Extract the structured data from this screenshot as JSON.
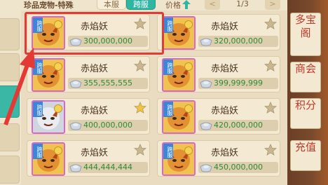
{
  "header": {
    "title": "珍品宠物-特殊",
    "tab_local": "本服",
    "tab_cross": "跨服",
    "price_sort_label": "价格",
    "page": "1/3"
  },
  "badge_text": "跨服",
  "listings": [
    {
      "name": "赤焰妖",
      "price": "300,000,000",
      "starred": false
    },
    {
      "name": "赤焰妖",
      "price": "320,000,000",
      "starred": false
    },
    {
      "name": "赤焰妖",
      "price": "355,555,555",
      "starred": false
    },
    {
      "name": "赤焰妖",
      "price": "399,999,999",
      "starred": false
    },
    {
      "name": "赤焰妖",
      "price": "400,000,000",
      "starred": true
    },
    {
      "name": "赤焰妖",
      "price": "420,000,000",
      "starred": false
    },
    {
      "name": "赤焰妖",
      "price": "444,444,444",
      "starred": false
    },
    {
      "name": "赤焰妖",
      "price": "450,000,000",
      "starred": false
    }
  ],
  "right_menu": [
    {
      "label": "多宝阁"
    },
    {
      "label": "商会"
    },
    {
      "label": "积分"
    },
    {
      "label": "充值"
    }
  ],
  "colors": {
    "accent_teal": "#2fb6a3",
    "price_green": "#2f8a32",
    "highlight_red": "#e53935"
  }
}
